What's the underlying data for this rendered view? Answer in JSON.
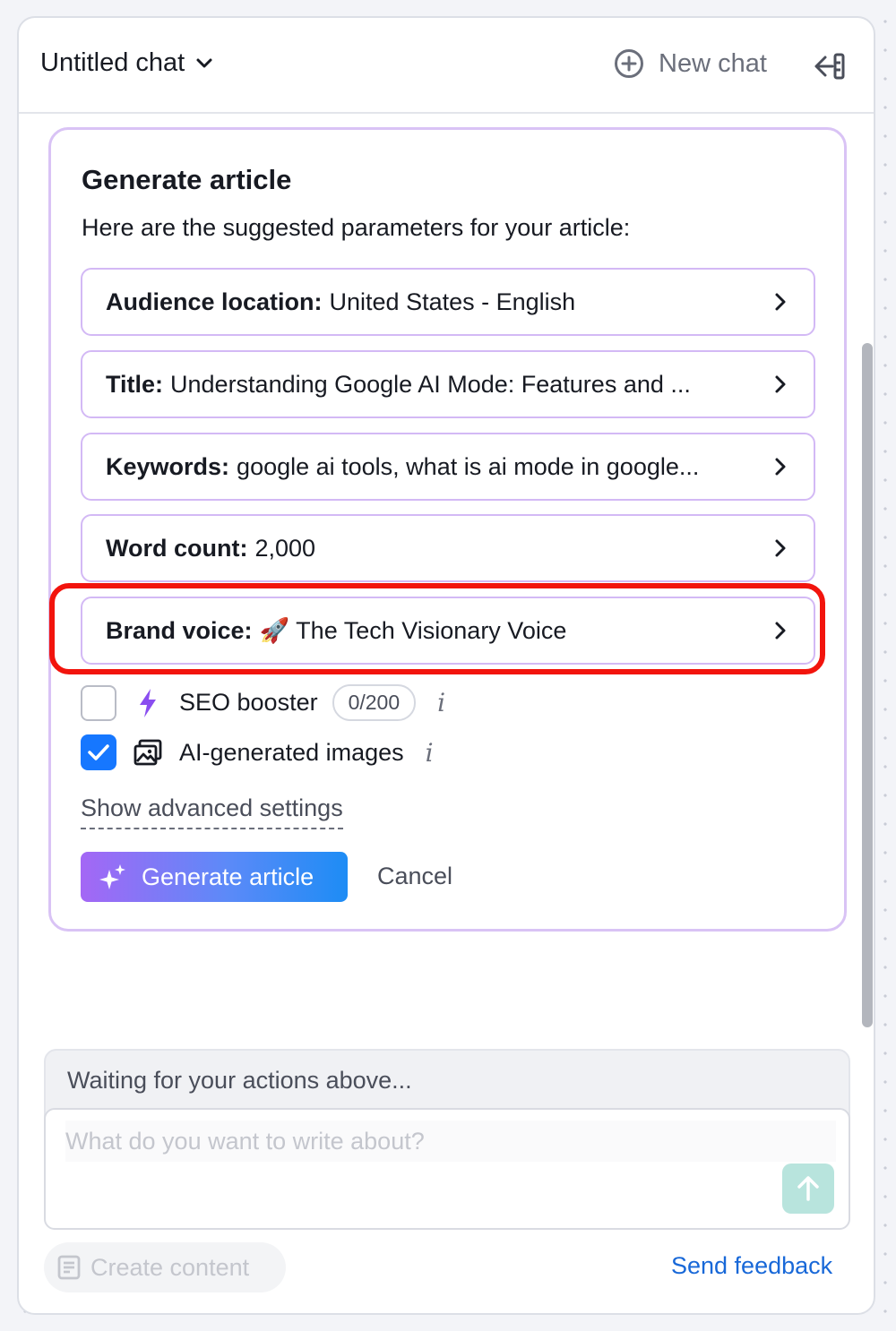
{
  "header": {
    "chat_title": "Untitled chat",
    "new_chat_label": "New chat"
  },
  "card": {
    "title": "Generate article",
    "subtitle": "Here are the suggested parameters for your article:",
    "params": [
      {
        "key": "Audience location:",
        "value": "United States - English"
      },
      {
        "key": "Title:",
        "value": "Understanding Google AI Mode: Features and ..."
      },
      {
        "key": "Keywords:",
        "value": "google ai tools, what is ai mode in google..."
      },
      {
        "key": "Word count:",
        "value": "2,000"
      },
      {
        "key": "Brand voice:",
        "value": "🚀 The Tech Visionary Voice"
      }
    ],
    "seo_booster": {
      "label": "SEO booster",
      "counter": "0/200",
      "checked": false
    },
    "ai_images": {
      "label": "AI-generated images",
      "checked": true
    },
    "advanced_label": "Show advanced settings",
    "generate_label": "Generate article",
    "cancel_label": "Cancel",
    "highlight_color": "#f2140d"
  },
  "composer": {
    "status": "Waiting for your actions above...",
    "placeholder": "What do you want to write about?",
    "value": ""
  },
  "footer": {
    "create_content_label": "Create content",
    "feedback_label": "Send feedback"
  },
  "colors": {
    "accent_purple": "#d3b9f5",
    "checkbox_blue": "#1677ff",
    "link_blue": "#1868d8",
    "send_teal": "#b8e4dd"
  }
}
